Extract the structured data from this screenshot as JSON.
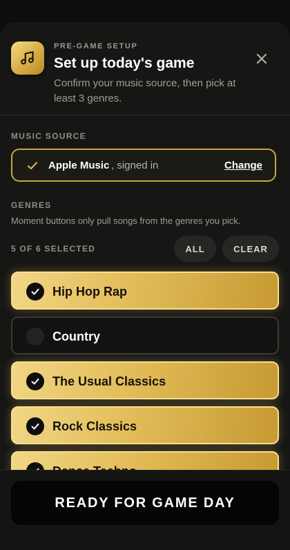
{
  "header": {
    "eyebrow": "PRE-GAME SETUP",
    "title": "Set up today's game",
    "subtitle": "Confirm your music source, then pick at least 3 genres."
  },
  "music_source": {
    "section_label": "MUSIC SOURCE",
    "name": "Apple Music",
    "status": ", signed in",
    "change_label": "Change"
  },
  "genres": {
    "section_label": "GENRES",
    "help_text": "Moment buttons only pull songs from the genres you pick.",
    "selected_count": "5 OF 6 SELECTED",
    "all_label": "ALL",
    "clear_label": "CLEAR",
    "items": [
      {
        "label": "Hip Hop Rap",
        "selected": true
      },
      {
        "label": "Country",
        "selected": false
      },
      {
        "label": "The Usual Classics",
        "selected": true
      },
      {
        "label": "Rock Classics",
        "selected": true
      },
      {
        "label": "Dance Techno",
        "selected": true
      }
    ]
  },
  "footer": {
    "cta_label": "READY FOR GAME DAY"
  },
  "colors": {
    "gold": "#e2bc58",
    "background": "#161615"
  }
}
